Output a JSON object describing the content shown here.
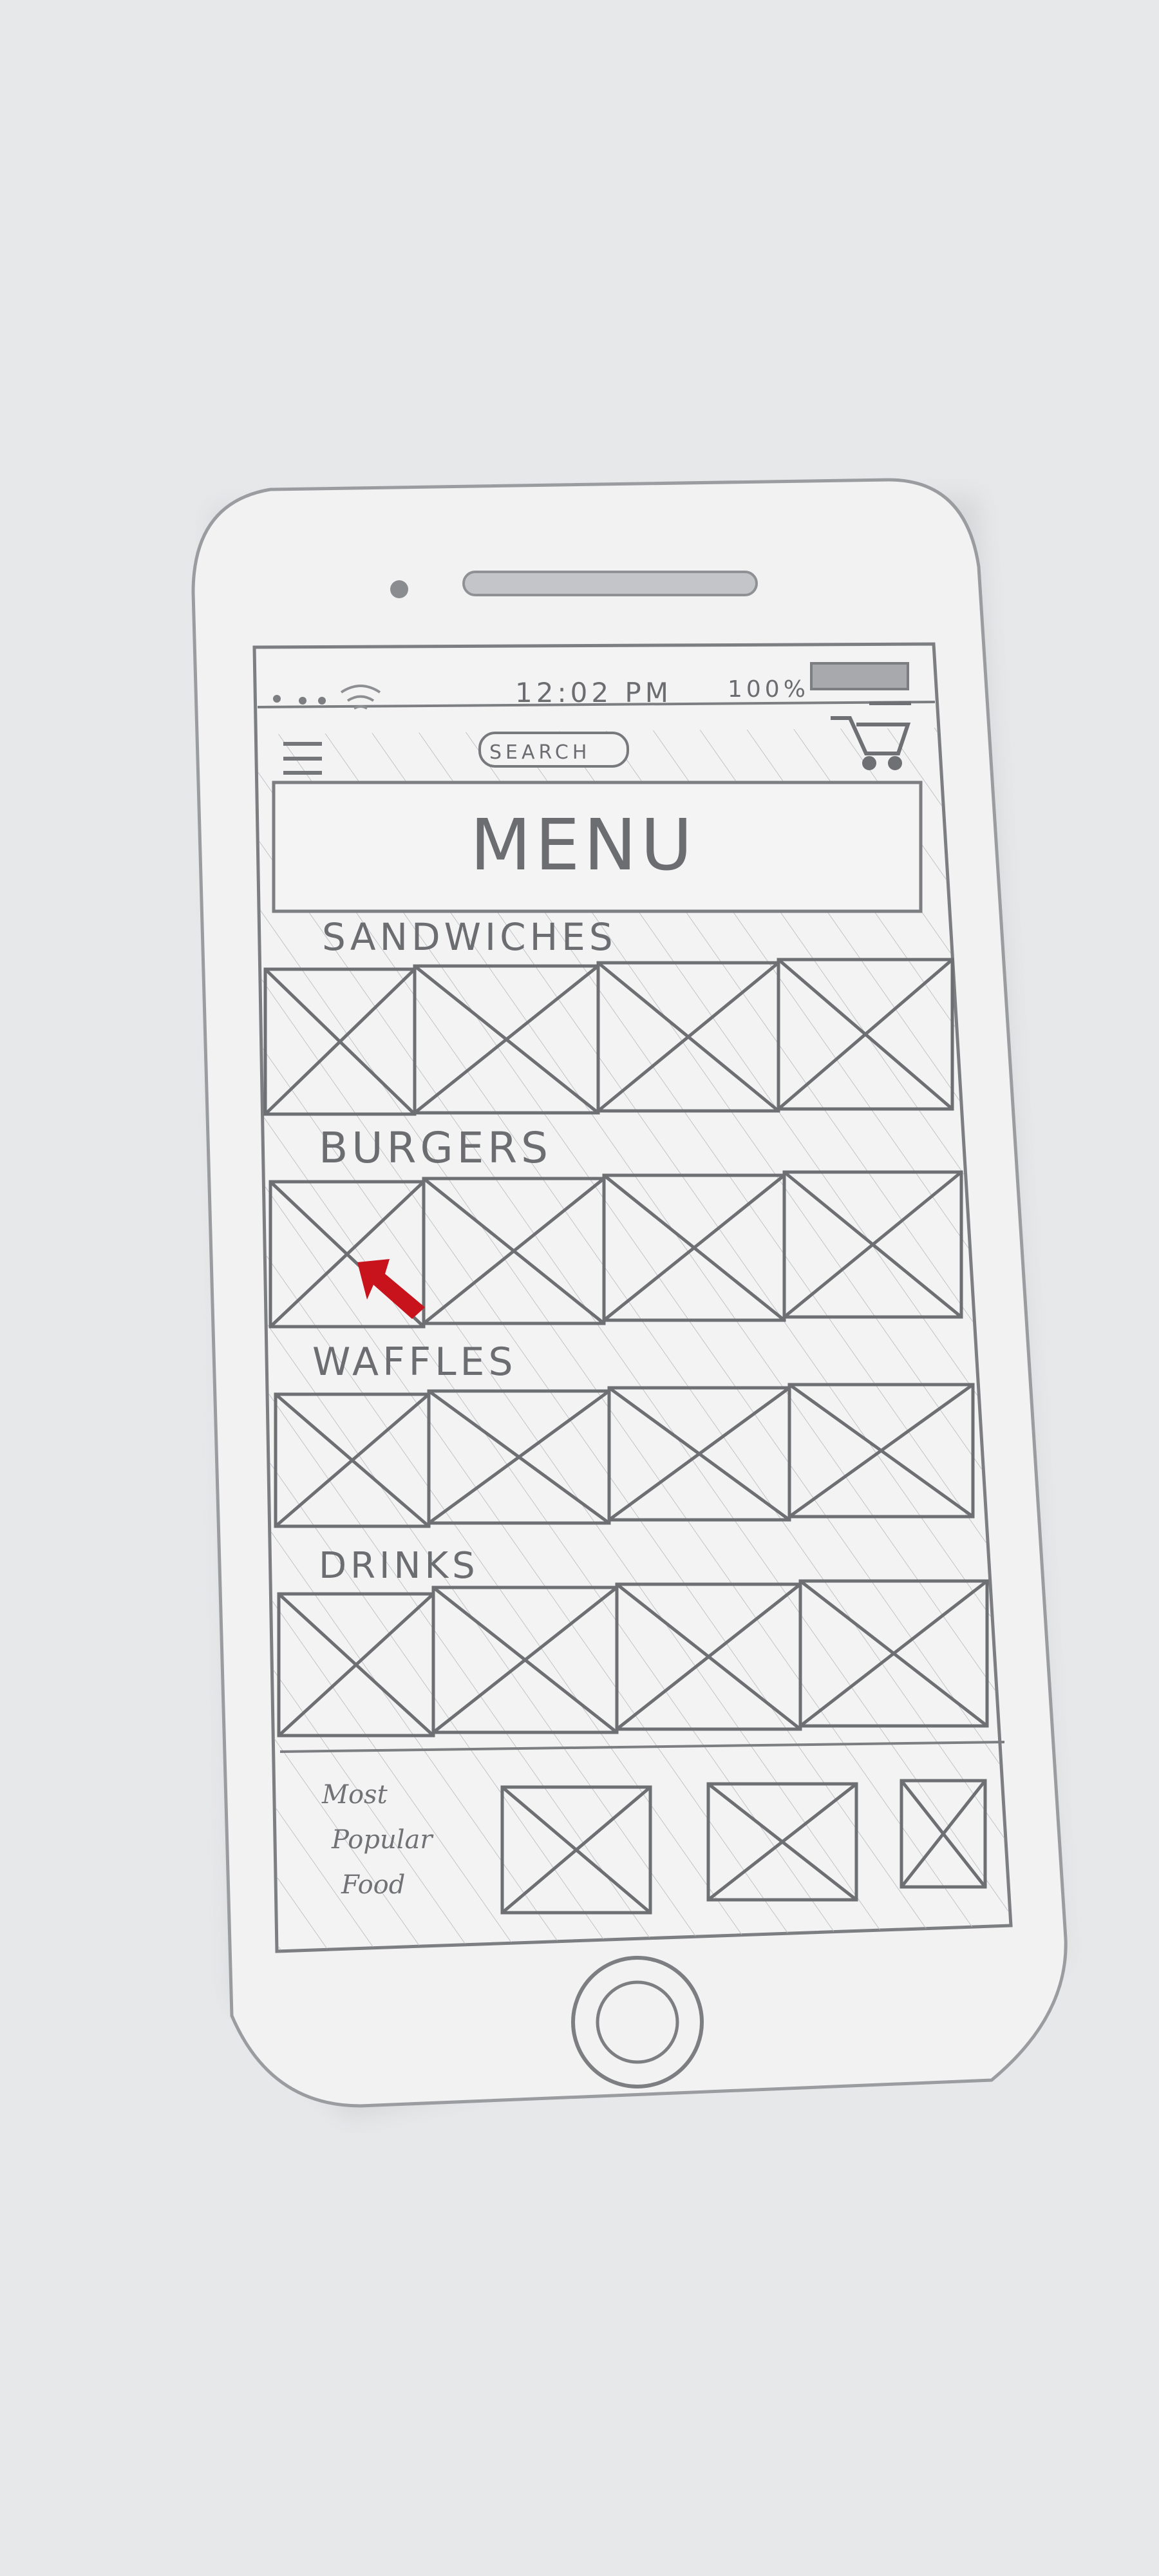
{
  "status_bar": {
    "time": "12:02 PM",
    "battery": "100%"
  },
  "header": {
    "menu_icon": "hamburger-icon",
    "search_label": "SEARCH",
    "cart_icon": "cart-icon"
  },
  "banner": {
    "title": "MENU"
  },
  "sections": [
    {
      "label": "SANDWICHES",
      "items": 4
    },
    {
      "label": "BURGERS",
      "items": 4
    },
    {
      "label": "WAFFLES",
      "items": 4
    },
    {
      "label": "DRINKS",
      "items": 4
    }
  ],
  "popular": {
    "line1": "Most",
    "line2": "Popular",
    "line3": "Food",
    "items": 3
  },
  "annotation": {
    "arrow_color": "#c8121c",
    "arrow_icon": "red-arrow-icon"
  },
  "colors": {
    "paper": "#f2f2f3",
    "pencil": "#6f7174",
    "background": "#e7e8ea"
  }
}
